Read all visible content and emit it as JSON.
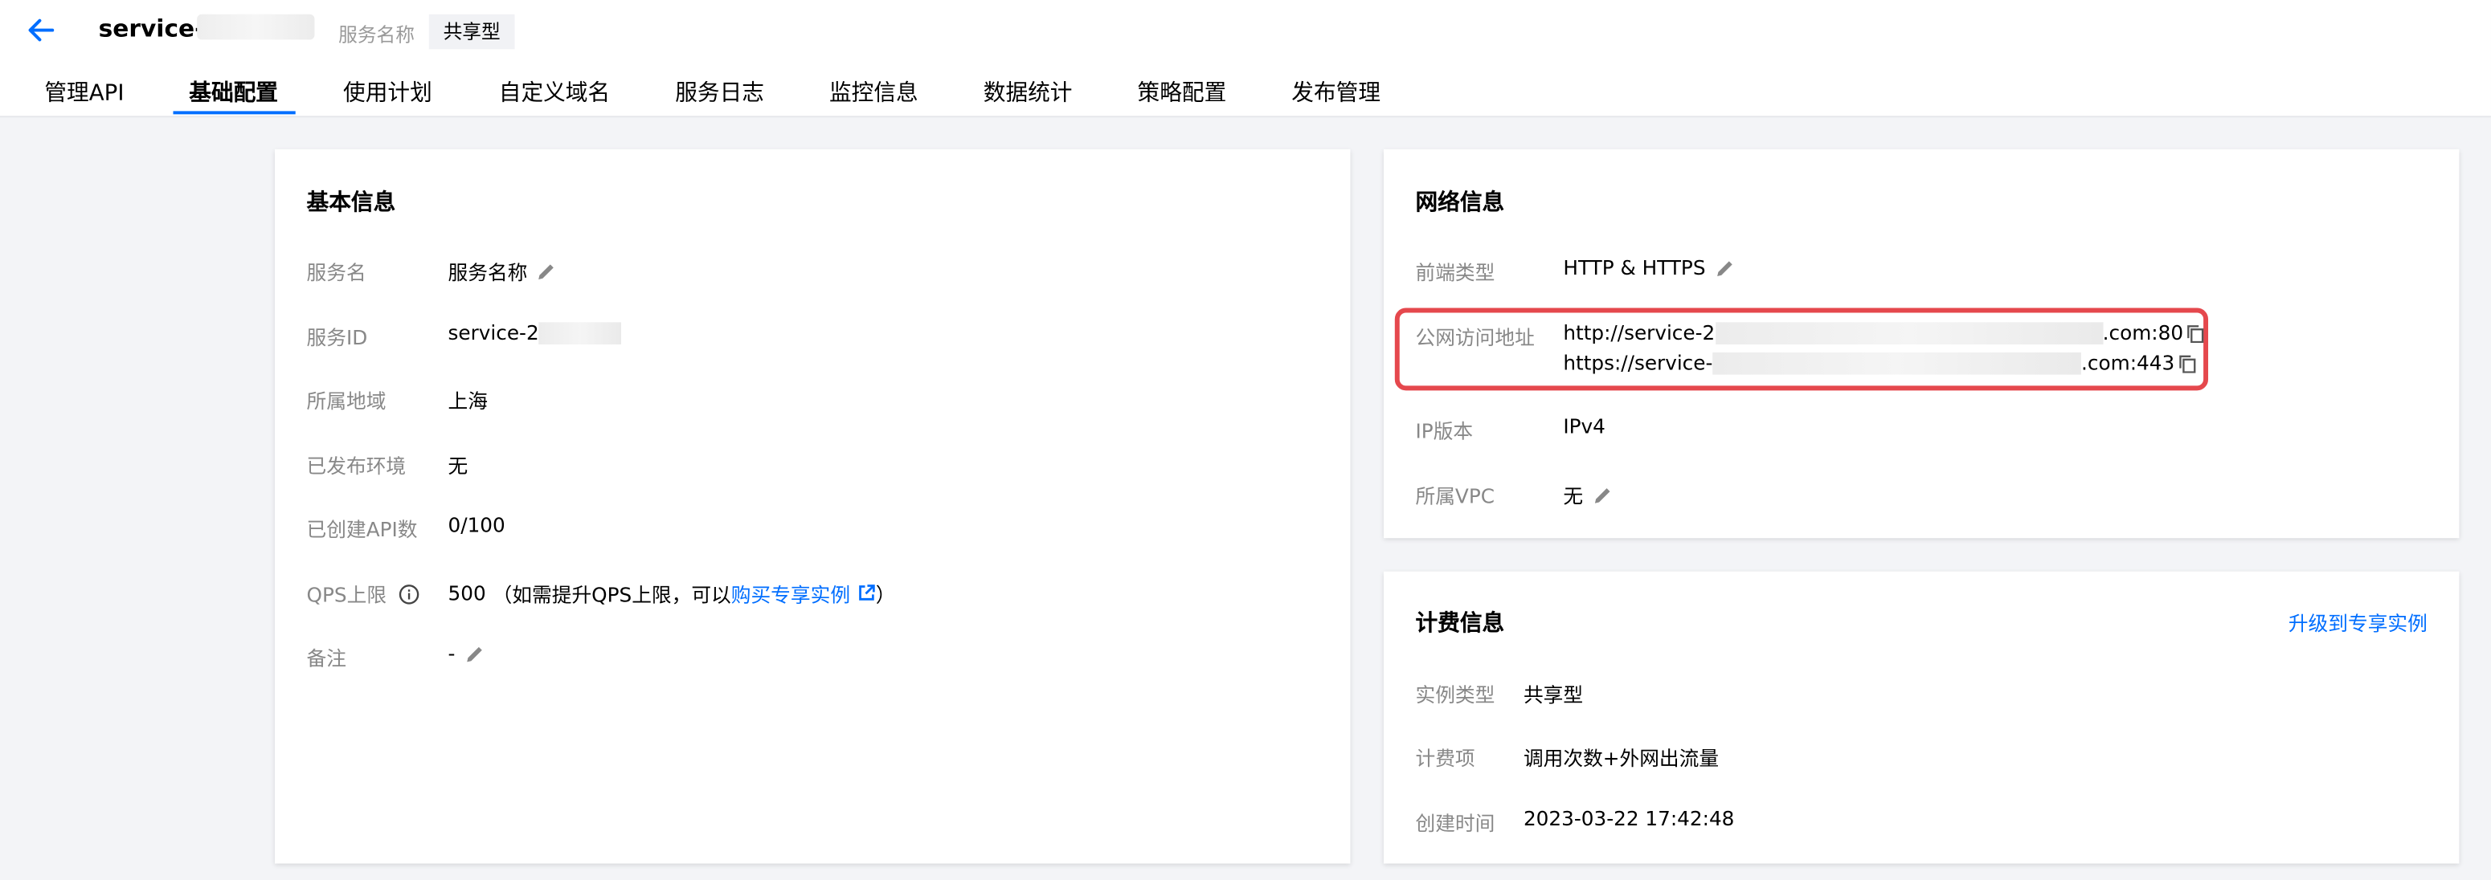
{
  "header": {
    "service_title": "service-",
    "service_name_label": "服务名称",
    "service_type_badge": "共享型"
  },
  "tabs": [
    {
      "label": "管理API"
    },
    {
      "label": "基础配置",
      "active": true
    },
    {
      "label": "使用计划"
    },
    {
      "label": "自定义域名"
    },
    {
      "label": "服务日志"
    },
    {
      "label": "监控信息"
    },
    {
      "label": "数据统计"
    },
    {
      "label": "策略配置"
    },
    {
      "label": "发布管理"
    }
  ],
  "basic_info": {
    "title": "基本信息",
    "service_name": {
      "label": "服务名",
      "value": "服务名称"
    },
    "service_id": {
      "label": "服务ID",
      "value": "service-2"
    },
    "region": {
      "label": "所属地域",
      "value": "上海"
    },
    "published_env": {
      "label": "已发布环境",
      "value": "无"
    },
    "api_count": {
      "label": "已创建API数",
      "value": "0/100"
    },
    "qps_limit": {
      "label": "QPS上限",
      "value": "500",
      "note_prefix": "（如需提升QPS上限，可以",
      "link_text": "购买专享实例",
      "note_suffix": "）"
    },
    "remark": {
      "label": "备注",
      "value": "-"
    }
  },
  "network_info": {
    "title": "网络信息",
    "frontend_type": {
      "label": "前端类型",
      "value": "HTTP & HTTPS"
    },
    "public_address": {
      "label": "公网访问地址",
      "http_prefix": "http://service-2",
      "http_suffix": ".com:80",
      "https_prefix": "https://service-",
      "https_suffix": ".com:443"
    },
    "ip_version": {
      "label": "IP版本",
      "value": "IPv4"
    },
    "vpc": {
      "label": "所属VPC",
      "value": "无"
    }
  },
  "billing_info": {
    "title": "计费信息",
    "upgrade_link": "升级到专享实例",
    "instance_type": {
      "label": "实例类型",
      "value": "共享型"
    },
    "billing_item": {
      "label": "计费项",
      "value": "调用次数+外网出流量"
    },
    "created_time": {
      "label": "创建时间",
      "value": "2023-03-22 17:42:48"
    }
  },
  "colors": {
    "accent": "#006eff",
    "highlight": "#e5484d",
    "label": "#888888",
    "background": "#f3f4f7"
  }
}
